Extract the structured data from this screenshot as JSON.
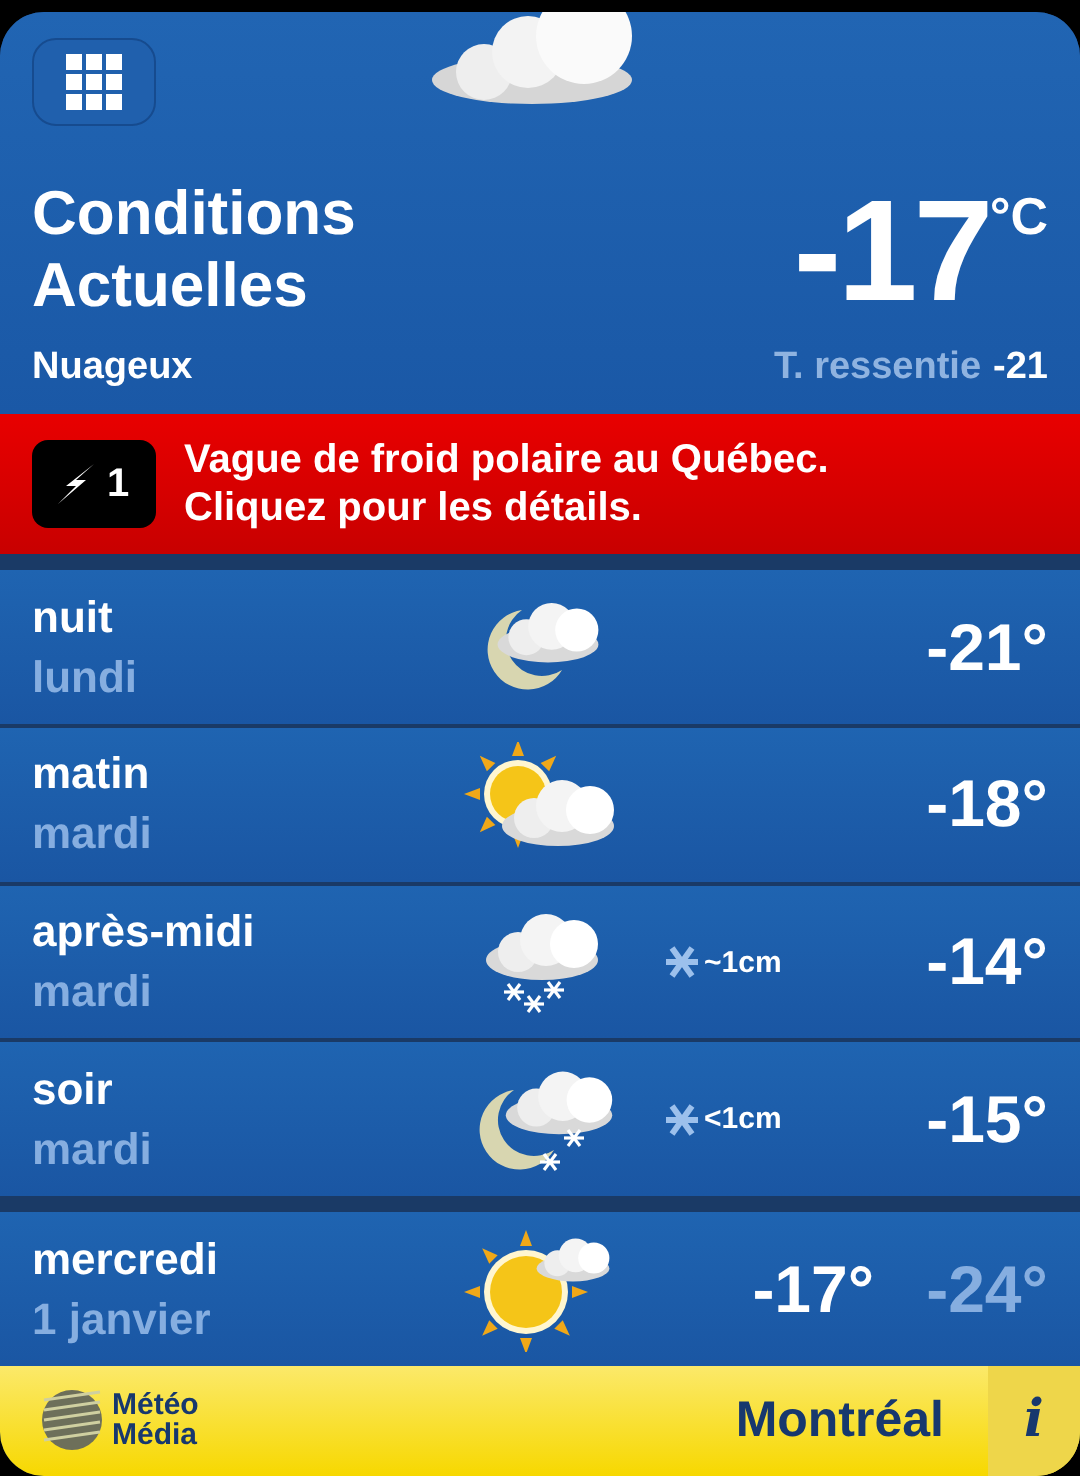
{
  "current": {
    "title_line1": "Conditions",
    "title_line2": "Actuelles",
    "condition": "Nuageux",
    "temperature": "-17",
    "unit": "°C",
    "feels_like_label": "T. ressentie",
    "feels_like_value": "-21",
    "kind": "cloud"
  },
  "alert": {
    "count": "1",
    "message_line1": "Vague de froid polaire au Québec.",
    "message_line2": "Cliquez pour les détails."
  },
  "periods": [
    {
      "period": "nuit",
      "day": "lundi",
      "kind": "moon-cloud",
      "temperature": "-21°"
    },
    {
      "period": "matin",
      "day": "mardi",
      "kind": "sun-cloud",
      "temperature": "-18°"
    },
    {
      "period": "après-midi",
      "day": "mardi",
      "kind": "snow-cloud",
      "snow": "~1cm",
      "temperature": "-14°"
    },
    {
      "period": "soir",
      "day": "mardi",
      "kind": "moon-snow",
      "snow": "<1cm",
      "temperature": "-15°"
    }
  ],
  "daily": [
    {
      "day": "mercredi",
      "date": "1 janvier",
      "kind": "sun-small-cloud",
      "high": "-17°",
      "low": "-24°"
    }
  ],
  "footer": {
    "logo_line1": "Météo",
    "logo_line2": "Média",
    "city": "Montréal",
    "info": "i"
  }
}
